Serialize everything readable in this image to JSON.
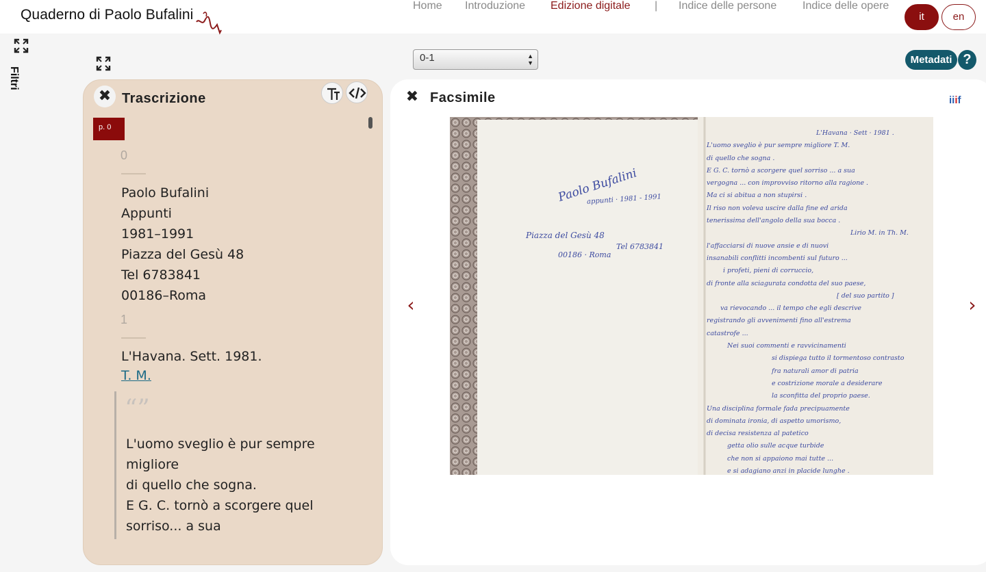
{
  "header": {
    "logo_text": "Quaderno di Paolo Bufalini",
    "nav": [
      {
        "label": "Home"
      },
      {
        "label": "Introduzione"
      },
      {
        "label": "Edizione digitale",
        "active": true
      },
      {
        "label": "|"
      },
      {
        "label": "Indice delle persone"
      },
      {
        "label": "Indice delle opere"
      }
    ],
    "lang_it": "it",
    "lang_en": "en"
  },
  "sidebar": {
    "filters_label": "Filtri"
  },
  "toolbar": {
    "page_select_value": "0-1",
    "metadata_label": "Metadati",
    "help_label": "?"
  },
  "transcription": {
    "title": "Trascrizione",
    "page_badge": "p. 0",
    "blocks": [
      {
        "line_no": "0",
        "lines": [
          "Paolo Bufalini",
          "Appunti",
          "1981–1991",
          "Piazza del Gesù 48",
          "Tel 6783841",
          "00186–Roma"
        ]
      },
      {
        "line_no": "1",
        "lines": [
          "L'Havana. Sett. 1981."
        ],
        "link": "T. M.",
        "quote_mark": "“”",
        "quote_lines": [
          "L'uomo sveglio è pur sempre",
          "migliore",
          "di quello che sogna.",
          "E G. C. tornò a scorgere quel",
          "sorriso... a sua"
        ]
      }
    ]
  },
  "facsimile": {
    "title": "Facsimile",
    "iiif_label": "iiif",
    "left_page": {
      "lines": [
        "Paolo Bufalini",
        "appunti · 1981 - 1991",
        "Piazza del Gesù 48",
        "Tel 6783841",
        "00186 · Roma"
      ]
    },
    "right_page": {
      "lines": [
        "L'Havana · Sett · 1981 .",
        "L'uomo sveglio è pur sempre migliore      T. M.",
        "di quello che sogna .",
        "E G. C. tornò a scorgere quel sorriso ... a sua",
        "vergogna ... con improvviso ritorno alla ragione .",
        "Ma ci si abitua a non stupirsi .",
        "Il riso non voleva uscire dalla fine ed arida",
        "tenerissima dell'angolo della sua bocca .",
        "Lirio M. in Th. M.",
        "l'affacciarsi di nuove ansie e di nuovi",
        "insanabili conflitti incombenti sul futuro ...",
        "i profeti, pieni di corruccio,",
        "di fronte alla sciagurata condotta del suo paese,",
        "[ del suo partito ]",
        "va rievocando ... il tempo che egli descrive",
        "registrando gli avvenimenti fino all'estrema",
        "catastrofe ...",
        "Nei suoi commenti e ravvicinamenti",
        "si dispiega tutto il tormentoso contrasto",
        "fra naturali amor di patria",
        "e costrizione morale a desiderare",
        "la sconfitta del proprio paese.",
        "Una disciplina formale fada precipuamente",
        "di dominata ironia, di aspetto umorismo,",
        "di decisa resistenza al patetico",
        "getta olio sulle acque turbide",
        "che non si appaiono mai tutte ...",
        "e si adagiano anzi in placide lunghe ."
      ]
    }
  }
}
